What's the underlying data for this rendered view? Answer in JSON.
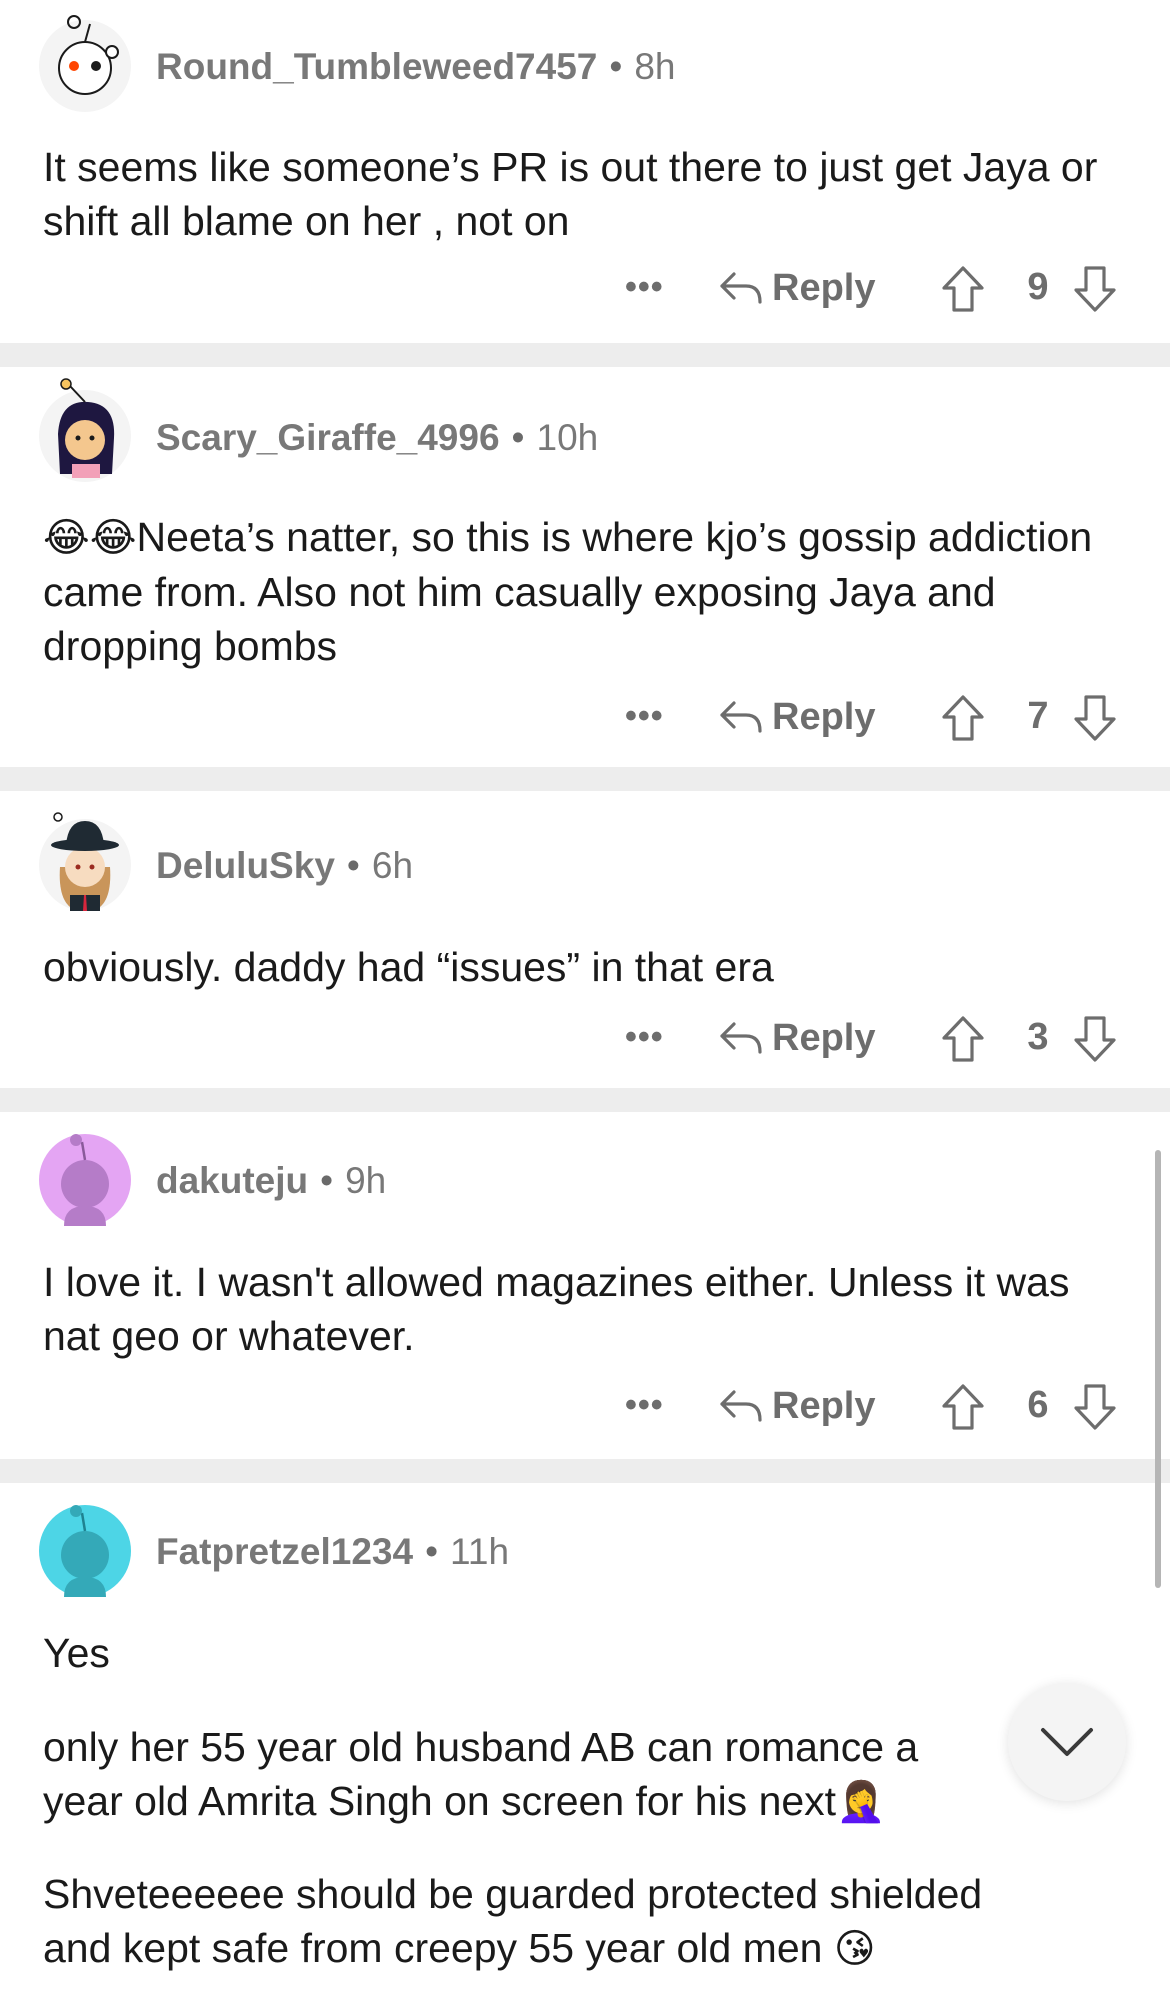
{
  "comments": [
    {
      "username": "Round_Tumbleweed7457",
      "time": "8h",
      "text": "It seems like someone’s PR is out there to just get Jaya or shift all blame on her , not on",
      "reply_label": "Reply",
      "score": "9",
      "avatar_color": "#f4f4f4"
    },
    {
      "username": "Scary_Giraffe_4996",
      "time": "10h",
      "emoji_prefix": "😂😂",
      "text": "Neeta’s natter, so this is where kjo’s gossip addiction came from. Also not him casually exposing Jaya and dropping bombs",
      "reply_label": "Reply",
      "score": "7",
      "avatar_color": "#f4f4f4"
    },
    {
      "username": "DeluluSky",
      "time": "6h",
      "text": "obviously. daddy had “issues” in that era",
      "reply_label": "Reply",
      "score": "3",
      "avatar_color": "#f4f4f4"
    },
    {
      "username": "dakuteju",
      "time": "9h",
      "text": "I love it. I wasn't allowed magazines either. Unless it was nat geo or whatever.",
      "reply_label": "Reply",
      "score": "6",
      "avatar_color": "#e4a5f3"
    },
    {
      "username": "Fatpretzel1234",
      "time": "11h",
      "paragraphs": [
        "Yes",
        "only her 55 year old husband AB can romance a",
        "year old Amrita Singh on screen for his next",
        "Shveteeeeee should be guarded protected shielded",
        "and kept safe from creepy 55 year old men"
      ],
      "emoji_1": "🤦‍♀️",
      "emoji_2": "😘",
      "avatar_color": "#4dd5e6"
    }
  ],
  "ui": {
    "more_icon": "ellipsis-icon",
    "scroll_down_icon": "chevron-down-icon"
  }
}
